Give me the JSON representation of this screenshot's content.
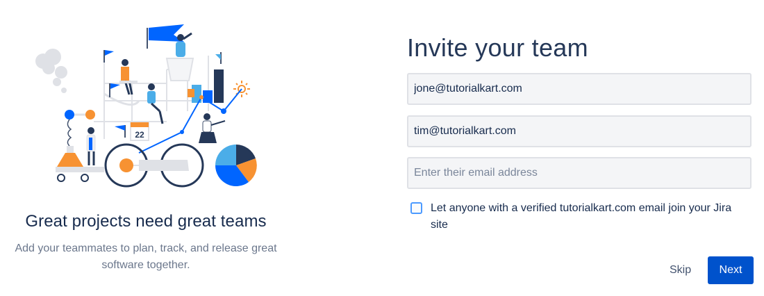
{
  "left_panel": {
    "title": "Great projects need great teams",
    "subtitle": "Add your teammates to plan, track, and release great software together.",
    "illustration_calendar_day": "22"
  },
  "form": {
    "heading": "Invite your team",
    "emails": [
      {
        "value": "jone@tutorialkart.com",
        "placeholder": ""
      },
      {
        "value": "tim@tutorialkart.com",
        "placeholder": ""
      },
      {
        "value": "",
        "placeholder": "Enter their email address"
      }
    ],
    "domain_checkbox": {
      "label": "Let anyone with a verified tutorialkart.com email join your Jira site",
      "checked": false
    },
    "skip_label": "Skip",
    "next_label": "Next"
  },
  "colors": {
    "primary": "#0052cc",
    "heading": "#253858",
    "text": "#172b4d",
    "muted": "#6b778c",
    "input_bg": "#f4f5f7",
    "input_border": "#dfe1e6",
    "checkbox_border": "#4c9aff",
    "illustration_orange": "#f79232",
    "illustration_blue": "#0065ff",
    "illustration_navy": "#253858",
    "illustration_light_blue": "#4bade8"
  }
}
